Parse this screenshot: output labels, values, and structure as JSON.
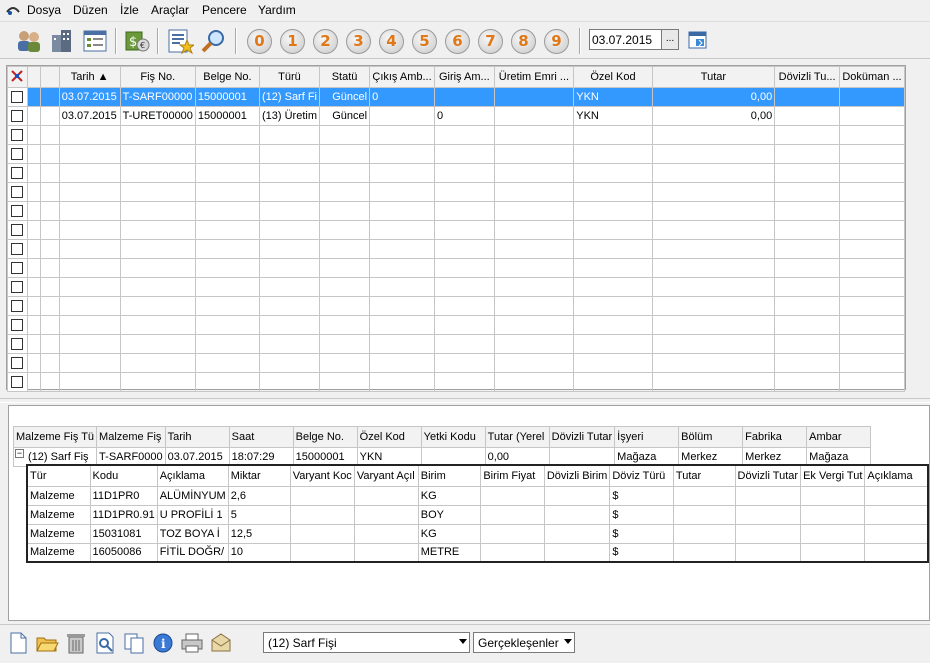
{
  "menu": {
    "items": [
      "Dosya",
      "Düzen",
      "İzle",
      "Araçlar",
      "Pencere",
      "Yardım"
    ]
  },
  "toolbar": {
    "numbers": [
      "0",
      "1",
      "2",
      "3",
      "4",
      "5",
      "6",
      "7",
      "8",
      "9"
    ],
    "date_value": "03.07.2015",
    "date_button": "..."
  },
  "grid1": {
    "columns": [
      "",
      "",
      "Tarih",
      "Fiş No.",
      "Belge No.",
      "Türü",
      "Statü",
      "Çıkış Amb...",
      "Giriş Am...",
      "Üretim Emri ...",
      "Özel Kod",
      "Tutar",
      "Dövizli Tu...",
      "Doküman ..."
    ],
    "rows": [
      [
        "03.07.2015",
        "T-SARF00000",
        "15000001",
        "(12) Sarf Fi",
        "Güncel",
        "0",
        "",
        "",
        "YKN",
        "0,00",
        "",
        ""
      ],
      [
        "03.07.2015",
        "T-URET00000",
        "15000001",
        "(13) Üretim",
        "Güncel",
        "",
        "0",
        "",
        "YKN",
        "0,00",
        "",
        ""
      ]
    ],
    "empty_rows": 14
  },
  "master": {
    "columns": [
      "Malzeme Fiş Tü",
      "Malzeme Fiş",
      "Tarih",
      "Saat",
      "Belge No.",
      "Özel Kod",
      "Yetki Kodu",
      "Tutar (Yerel",
      "Dövizli Tutar",
      "İşyeri",
      "Bölüm",
      "Fabrika",
      "Ambar"
    ],
    "row": [
      "(12) Sarf Fiş",
      "T-SARF0000",
      "03.07.2015",
      "18:07:29",
      "15000001",
      "YKN",
      "",
      "0,00",
      "",
      "Mağaza",
      "Merkez",
      "Merkez",
      "Mağaza"
    ]
  },
  "sub": {
    "columns": [
      "Tür",
      "Kodu",
      "Açıklama",
      "Miktar",
      "Varyant Koc",
      "Varyant Açıl",
      "Birim",
      "Birim Fiyat",
      "Dövizli Birim",
      "Döviz Türü",
      "Tutar",
      "Dövizli Tutar",
      "Ek Vergi Tut",
      "Açıklama"
    ],
    "rows": [
      [
        "Malzeme",
        "11D1PR0",
        "ALÜMİNYUM",
        "2,6",
        "",
        "",
        "KG",
        "",
        "",
        "$",
        "",
        "",
        "",
        ""
      ],
      [
        "Malzeme",
        "11D1PR0.91",
        "U PROFİLİ 1",
        "5",
        "",
        "",
        "BOY",
        "",
        "",
        "$",
        "",
        "",
        "",
        ""
      ],
      [
        "Malzeme",
        "15031081",
        "TOZ BOYA İ",
        "12,5",
        "",
        "",
        "KG",
        "",
        "",
        "$",
        "",
        "",
        "",
        ""
      ],
      [
        "Malzeme",
        "16050086",
        "FİTİL DOĞR/",
        "10",
        "",
        "",
        "METRE",
        "",
        "",
        "$",
        "",
        "",
        "",
        ""
      ]
    ]
  },
  "bottombar": {
    "type_select": "(12) Sarf Fişi",
    "filter_select": "Gerçekleşenler"
  },
  "colors": {
    "selection": "#3399ff",
    "number_text": "#e07818"
  }
}
